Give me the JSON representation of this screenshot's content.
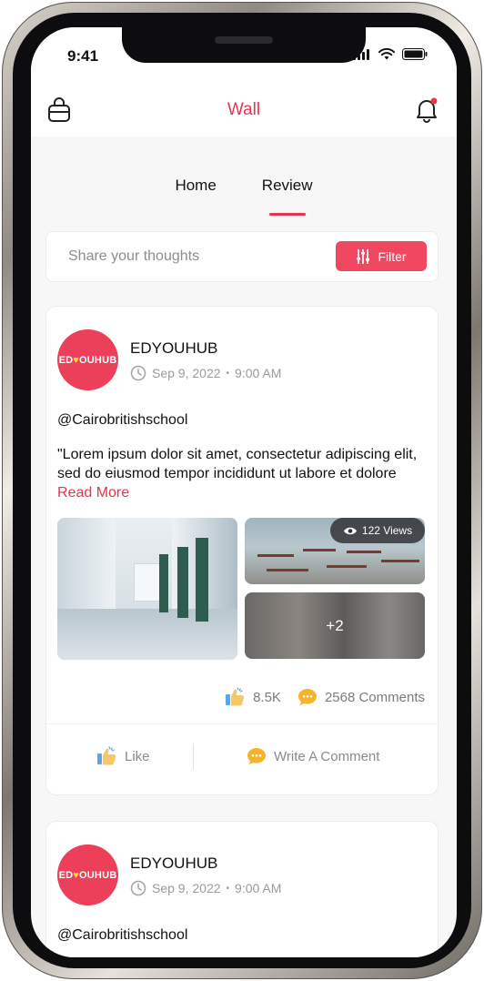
{
  "status": {
    "time": "9:41"
  },
  "header": {
    "title": "Wall"
  },
  "tabs": [
    {
      "label": "Home"
    },
    {
      "label": "Review"
    }
  ],
  "share": {
    "placeholder": "Share your thoughts",
    "filter_label": "Filter"
  },
  "posts": [
    {
      "author": "EDYOUHUB",
      "avatar_text": {
        "part1": "ED",
        "heart": "♥",
        "part2": "OUHUB"
      },
      "date": "Sep 9, 2022",
      "time": "9:00 AM",
      "mention": "@Cairobritishschool",
      "text": "\"Lorem ipsum dolor sit amet, consectetur adipiscing elit, sed do eiusmod tempor incididunt ut labore et dolore",
      "read_more": "Read More",
      "views": "122 Views",
      "more_images": "+2",
      "likes": "8.5K",
      "comments": "2568 Comments",
      "like_label": "Like",
      "comment_label": "Write A Comment"
    },
    {
      "author": "EDYOUHUB",
      "avatar_text": {
        "part1": "ED",
        "heart": "♥",
        "part2": "OUHUB"
      },
      "date": "Sep 9, 2022",
      "time": "9:00 AM",
      "mention": "@Cairobritishschool"
    }
  ],
  "colors": {
    "accent": "#e8344e",
    "filter_bg": "#f04860",
    "avatar_bg": "#ec3f59",
    "comment_icon": "#f6b22b"
  }
}
